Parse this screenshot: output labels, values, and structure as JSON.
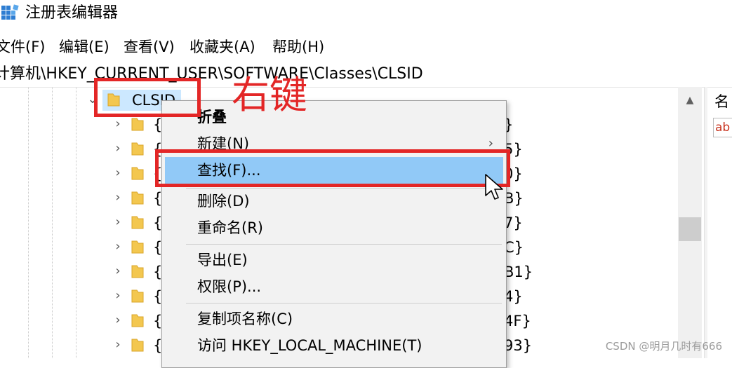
{
  "window": {
    "title": "注册表编辑器"
  },
  "menu": [
    "文件(F)",
    "编辑(E)",
    "查看(V)",
    "收藏夹(A)",
    "帮助(H)"
  ],
  "address": "计算机\\HKEY_CURRENT_USER\\SOFTWARE\\Classes\\CLSID",
  "tree": {
    "selected": "CLSID",
    "children_left": [
      "{",
      "{",
      "{",
      "{",
      "{",
      "{",
      "{",
      "{",
      "{",
      "{",
      "{"
    ],
    "children_right": [
      "}",
      "5}",
      "0}",
      "B}",
      "7}",
      "C}",
      "B1}",
      "4}",
      "4F}",
      "93}",
      ""
    ]
  },
  "right_pane": {
    "column_name": "名",
    "value_icon": "ab"
  },
  "context_menu": {
    "items": [
      {
        "label": "折叠",
        "bold": true
      },
      {
        "label": "新建(N)",
        "submenu_arrow": "›"
      },
      {
        "label": "查找(F)...",
        "highlighted": true
      },
      {
        "label": "删除(D)"
      },
      {
        "label": "重命名(R)"
      },
      {
        "label": "导出(E)"
      },
      {
        "label": "权限(P)..."
      },
      {
        "label": "复制项名称(C)"
      },
      {
        "label": "访问 HKEY_LOCAL_MACHINE(T)"
      }
    ]
  },
  "annotation": {
    "text": "右键",
    "color": "#e32626"
  },
  "watermark": "CSDN @明月几时有666",
  "colors": {
    "selection": "#cce8ff",
    "menu_highlight": "#91c9f7",
    "annotation_red": "#e32626",
    "folder": "#f3c74f"
  },
  "icons": {
    "app": "registry-editor-icon",
    "folder": "folder-icon",
    "expand": "chevron-right-icon",
    "collapse": "chevron-down-icon",
    "string_value": "string-value-icon",
    "cursor": "mouse-pointer-icon"
  }
}
